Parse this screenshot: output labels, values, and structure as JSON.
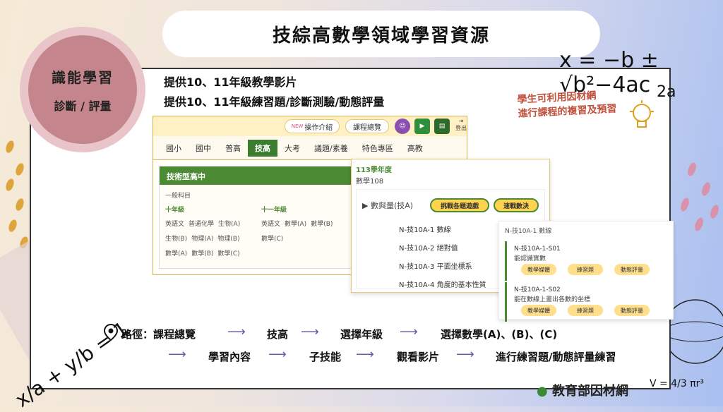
{
  "title": "技綜高數學領域學習資源",
  "badge": {
    "line1": "識能學習",
    "line2": "診斷 / 評量"
  },
  "intro": {
    "line1": "提供10、11年級教學影片",
    "line2": "提供10、11年級練習題/診斷測驗/動態評量"
  },
  "note": {
    "line1": "學生可利用因材網",
    "line2": "進行課程的複習及預習"
  },
  "app": {
    "new_tag": "NEW",
    "op_intro": "操作介紹",
    "course_overview": "課程總覽",
    "logout": "登出",
    "tabs": [
      "國小",
      "國中",
      "普高",
      "技高",
      "大考",
      "議題/素養",
      "特色專區",
      "高教"
    ],
    "grade_title": "技術型高中",
    "general": "一般科目",
    "grade10": "十年級",
    "grade11": "十一年級",
    "g10_subjects": [
      "英語文",
      "普通化學",
      "生物(A)",
      "生物(B)",
      "物理(A)",
      "物理(B)",
      "數學(A)",
      "數學(B)",
      "數學(C)"
    ],
    "g11_subjects": [
      "英語文",
      "數學(A)",
      "數學(B)",
      "數學(C)"
    ]
  },
  "panel2": {
    "year": "113學年度",
    "subject": "數學108",
    "section": "數與量(技A)",
    "btn_challenge": "挑戰各題遊戲",
    "btn_speed": "速戰數決",
    "units": [
      "N-技10A-1  數線",
      "N-技10A-2  絕對值",
      "N-技10A-3  平面坐標系",
      "N-技10A-4  角度的基本性質"
    ]
  },
  "panel3": {
    "header": "N-技10A-1 數線",
    "cards": [
      {
        "code": "N-技10A-1-S01",
        "desc": "能認識實數"
      },
      {
        "code": "N-技10A-1-S02",
        "desc": "能在數線上畫出各數的坐標"
      }
    ],
    "buttons": [
      "教學媒體",
      "練習題",
      "動態評量"
    ]
  },
  "path": {
    "label": "路徑：課程總覽",
    "row1": [
      "技高",
      "選擇年級",
      "選擇數學(A)、(B)、(C)"
    ],
    "row2": [
      "學習內容",
      "子技能",
      "觀看影片",
      "進行練習題/動態評量練習"
    ]
  },
  "brand": "教育部因材網"
}
